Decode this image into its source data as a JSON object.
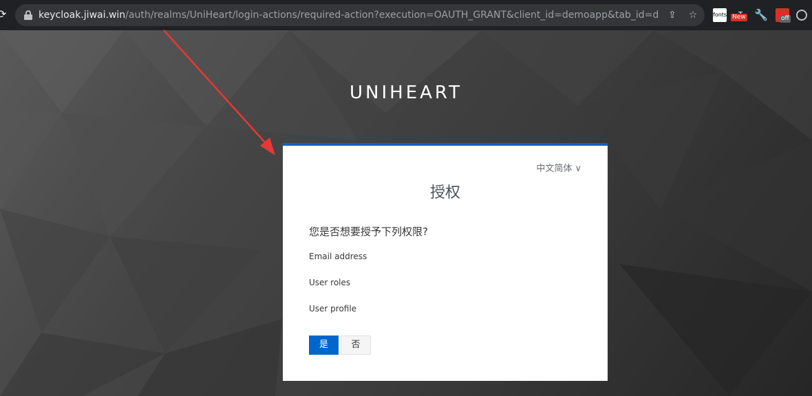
{
  "browser": {
    "url_host": "keycloak.jiwai.win",
    "url_path": "/auth/realms/UniHeart/login-actions/required-action?execution=OAUTH_GRANT&client_id=demoapp&tab_id=dYWeu_kir...",
    "extensions": {
      "fonts_label": "fonts",
      "new_badge": "New",
      "off_badge": "off"
    }
  },
  "page": {
    "realm_name": "UNIHEART"
  },
  "card": {
    "language": "中文简体 ∨",
    "title": "授权",
    "question": "您是否想要授予下列权限?",
    "scopes": [
      "Email address",
      "User roles",
      "User profile"
    ],
    "yes_label": "是",
    "no_label": "否"
  },
  "colors": {
    "accent": "#0066cc",
    "annotation_arrow": "#e53935"
  }
}
